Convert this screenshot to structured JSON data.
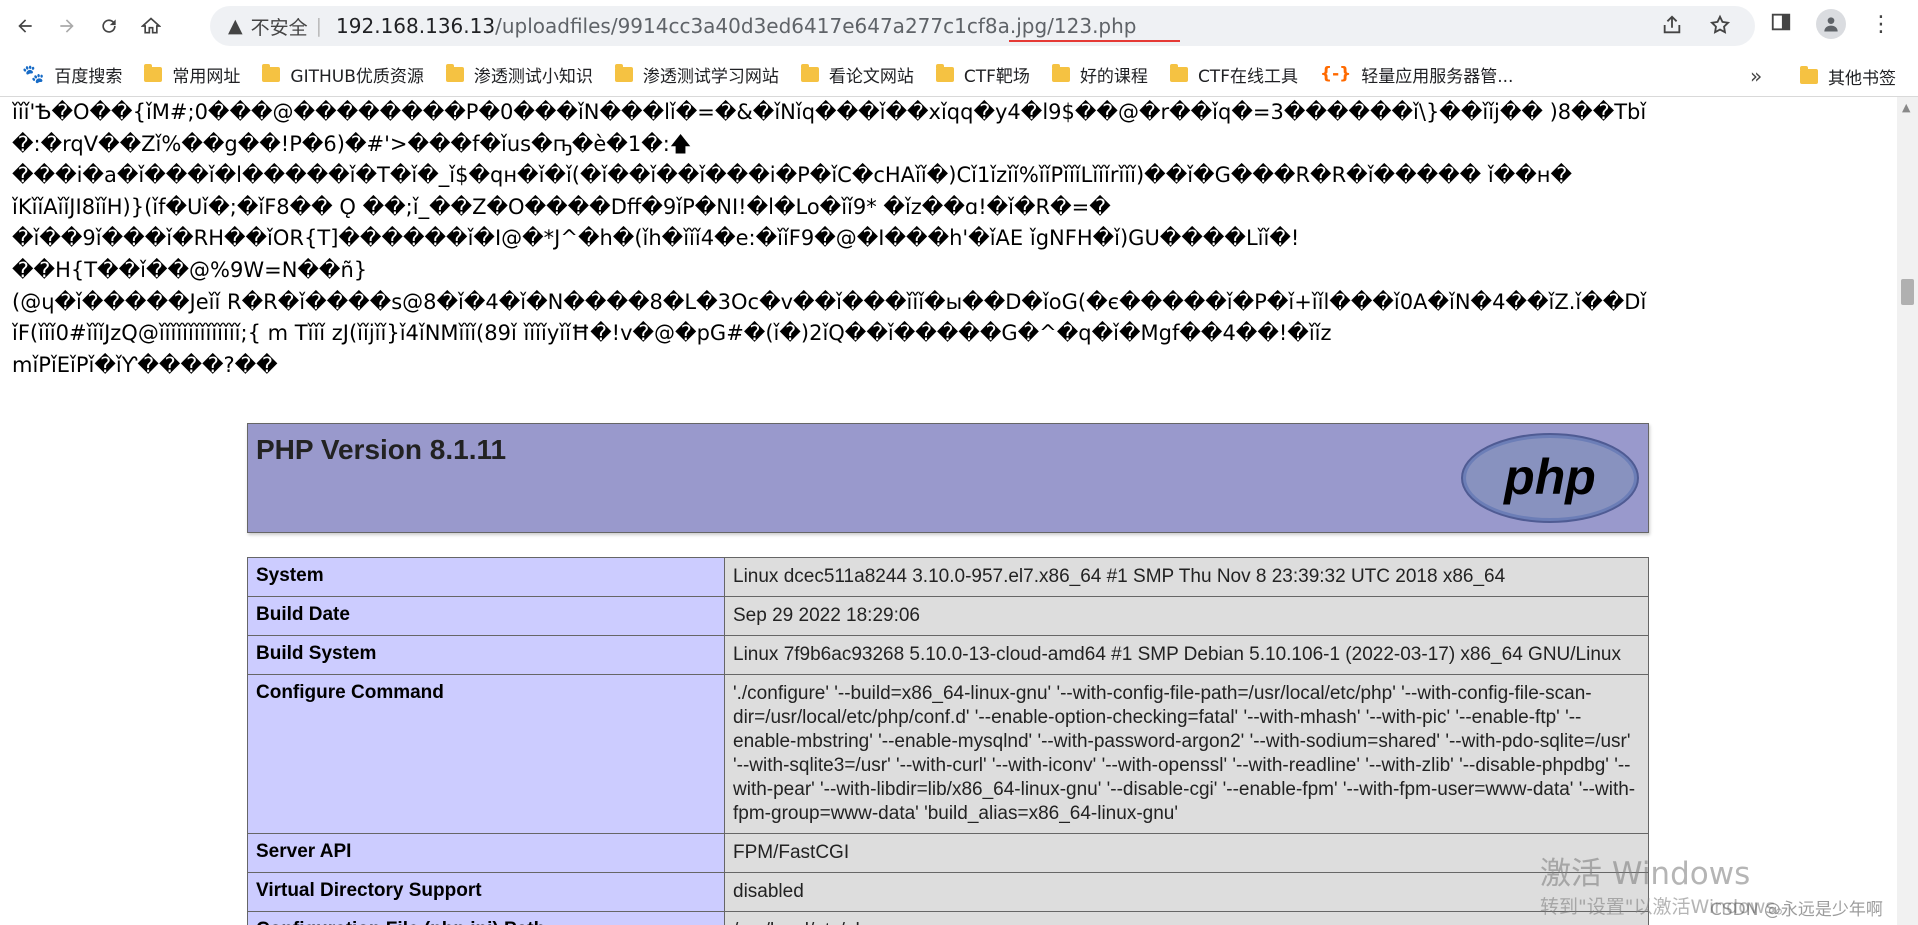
{
  "browser": {
    "security_label": "不安全",
    "url_host": "192.168.136.13",
    "url_path": "/uploadfiles/9914cc3a40d3ed6417e647a277c1cf8a.jpg/123.php"
  },
  "bookmarks": [
    {
      "label": "百度搜索",
      "icon": "baidu-icon"
    },
    {
      "label": "常用网址",
      "icon": "folder-icon"
    },
    {
      "label": "GITHUB优质资源",
      "icon": "folder-icon"
    },
    {
      "label": "渗透测试小知识",
      "icon": "folder-icon"
    },
    {
      "label": "渗透测试学习网站",
      "icon": "folder-icon"
    },
    {
      "label": "看论文网站",
      "icon": "folder-icon"
    },
    {
      "label": "CTF靶场",
      "icon": "folder-icon"
    },
    {
      "label": "好的课程",
      "icon": "folder-icon"
    },
    {
      "label": "CTF在线工具",
      "icon": "folder-icon"
    },
    {
      "label": "轻量应用服务器管...",
      "icon": "aliyun-icon"
    }
  ],
  "bookmarks_more": "»",
  "other_bookmarks": "其他书签",
  "garbled_lines": [
    "ǐǐǐ'Ѣ�O��{ǐM#;0���@��������P�0���ǐN���lǐ�=�&�ǐNǐq���ǐ��xǐqq�y4�l9$��@�r��ǐq�=3������ǐ\\}��ǐǐj�� )8��Tbǐ",
    "�:�rqV��Zǐ%��g��!P�6)�#'>���f�ǐus�ҧ�è�1�:🡅",
    "���i�a�ǐ���ǐ�l�����ǐ�T�ǐ�_ǐ$�qн�ǐ�ǐ(�ǐ��ǐ��ǐ���i�P�ǐC�cHAǐǐ�)Cǐ1ǐzǐǐ%ǐǐPǐǐǐLǐǐǐrǐǐǐ)��ǐ�G���R�R�ǐ����� ǐ��н�",
    "ǐKǐǐAǐǐJI8ǐǐH)}(ǐf�Uǐ�;�ǐF8�� Ǫ ��;ǐ_��Z�O����Dﬀ�9ǐP�NI!�l�Lo�ǐǐ9* �ǐz��ɑ!�ǐ�R�=�",
    "�ǐ��9ǐ���ǐ�RH��ǐOR{T]������ǐ�I@�*J^�h�(ǐh�ǐǐǐ4�e:�ǐǐF9�@�I���h'�ǐAE ǐgNFH�ǐ)GU����Lǐǐ�!",
    "��H{T��ǐ��@%9W=N��ñ}",
    "(@ɥ�ǐ�����Jeǐǐ R�R�ǐ����s@8�ǐ�4�ǐ�N����8�L�3Oc�v��ǐ���ǐǐǐ�ы��D�ǐoG(�є�����ǐ�P�ǐ+ǐǐl���ǐ0A�ǐN�4��ǐZ.ǐ��Dǐ",
    "ǐF(ǐǐǐ0#ǐǐǐJzQ@ǐǐǐǐǐǐǐǐǐǐǐǐǐǐ;{ m Tǐǐǐ zJ(ǐǐjǐǐ}ǐ4ǐNMǐǐǐ(89ǐ ǐǐǐǐyǐǐĦ�!v�@�pG#�(ǐ�)2ǐQ��ǐ�����G�^�q�ǐ�Mgf��4��!�ǐǐz",
    "mǐPǐEǐPǐ�ǐƳ����?��"
  ],
  "php": {
    "version_title": "PHP Version 8.1.11",
    "logo_text": "php",
    "rows": [
      {
        "key": "System",
        "value": "Linux dcec511a8244 3.10.0-957.el7.x86_64 #1 SMP Thu Nov 8 23:39:32 UTC 2018 x86_64"
      },
      {
        "key": "Build Date",
        "value": "Sep 29 2022 18:29:06"
      },
      {
        "key": "Build System",
        "value": "Linux 7f9b6ac93268 5.10.0-13-cloud-amd64 #1 SMP Debian 5.10.106-1 (2022-03-17) x86_64 GNU/Linux"
      },
      {
        "key": "Configure Command",
        "value": "'./configure' '--build=x86_64-linux-gnu' '--with-config-file-path=/usr/local/etc/php' '--with-config-file-scan-dir=/usr/local/etc/php/conf.d' '--enable-option-checking=fatal' '--with-mhash' '--with-pic' '--enable-ftp' '--enable-mbstring' '--enable-mysqlnd' '--with-password-argon2' '--with-sodium=shared' '--with-pdo-sqlite=/usr' '--with-sqlite3=/usr' '--with-curl' '--with-iconv' '--with-openssl' '--with-readline' '--with-zlib' '--disable-phpdbg' '--with-pear' '--with-libdir=lib/x86_64-linux-gnu' '--disable-cgi' '--enable-fpm' '--with-fpm-user=www-data' '--with-fpm-group=www-data' 'build_alias=x86_64-linux-gnu'"
      },
      {
        "key": "Server API",
        "value": "FPM/FastCGI"
      },
      {
        "key": "Virtual Directory Support",
        "value": "disabled"
      },
      {
        "key": "Configuration File (php.ini) Path",
        "value": "/usr/local/etc/php"
      }
    ]
  },
  "watermark": {
    "line1": "激活 Windows",
    "line2": "转到\"设置\"以激活Windows。",
    "csdn": "CSDN @永远是少年啊"
  }
}
